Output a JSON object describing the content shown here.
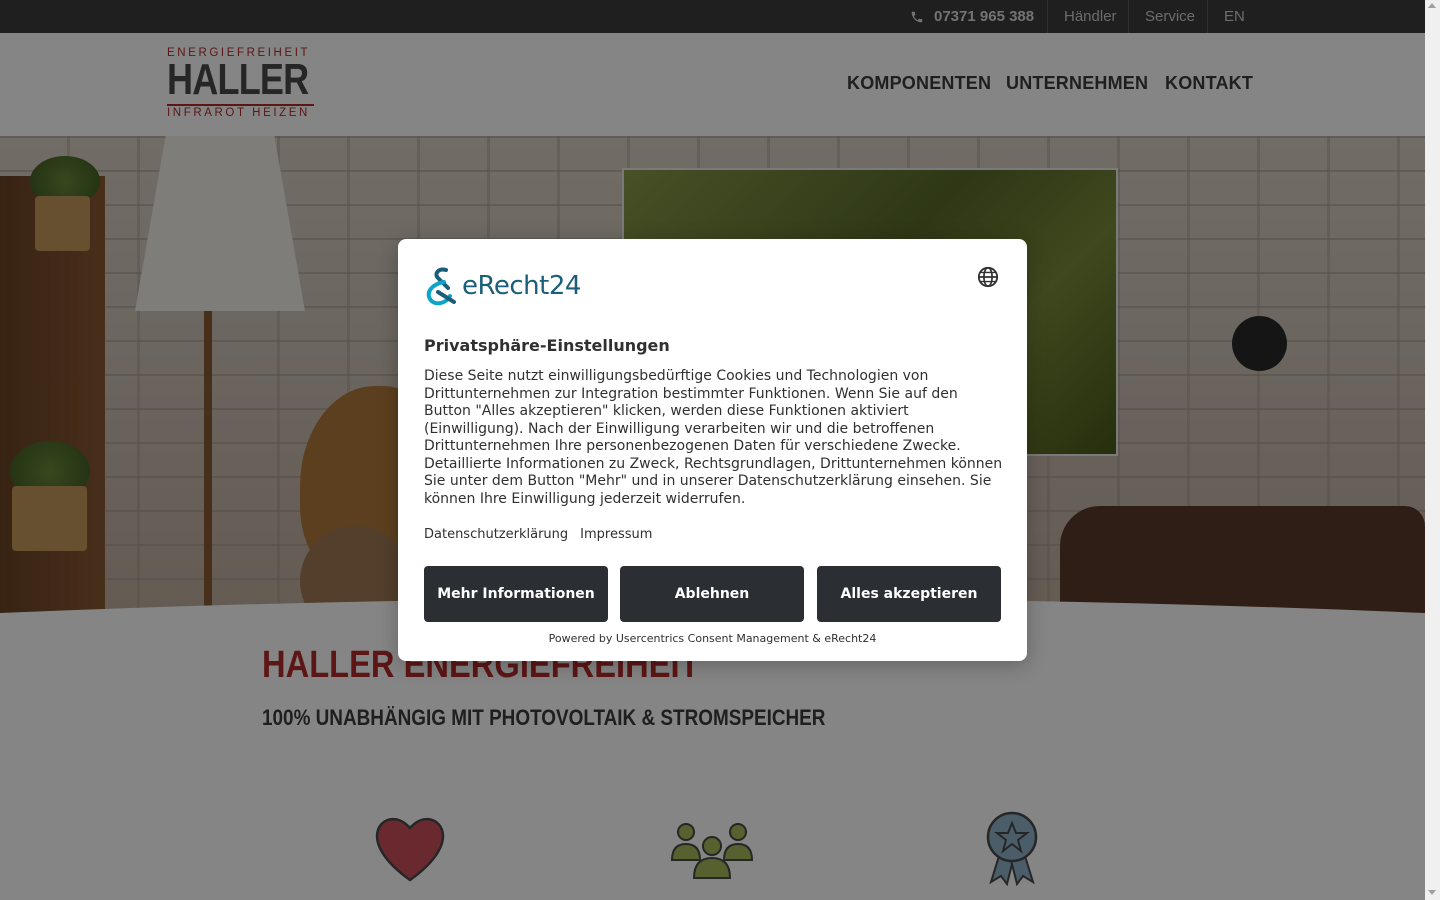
{
  "topbar": {
    "phone": "07371 965 388",
    "links": [
      "Händler",
      "Service",
      "EN"
    ]
  },
  "logo": {
    "line1": "ENERGIEFREIHEIT",
    "brand": "HALLER",
    "line3": "INFRAROT HEIZEN",
    "registered": "®"
  },
  "nav": [
    "KOMPONENTEN",
    "UNTERNEHMEN",
    "KONTAKT"
  ],
  "content": {
    "headline": "HALLER ENERGIEFREIHEIT",
    "subheadline": "100% UNABHÄNGIG MIT PHOTOVOLTAIK & STROMSPEICHER",
    "feature_icons": [
      "heart-icon",
      "people-icon",
      "award-badge-icon"
    ]
  },
  "consent": {
    "brand": "eRecht24",
    "title": "Privatsphäre-Einstellungen",
    "body": "Diese Seite nutzt einwilligungsbedürftige Cookies und Technologien von Drittunternehmen zur Integration bestimmter Funktionen. Wenn Sie auf den Button \"Alles akzeptieren\" klicken, werden diese Funktionen aktiviert (Einwilligung). Nach der Einwilligung verarbeiten wir und die betroffenen Drittunternehmen Ihre personenbezogenen Daten für verschiedene Zwecke. Detaillierte Informationen zu Zweck, Rechtsgrundlagen, Drittunternehmen können Sie unter dem Button \"Mehr\" und in unserer Datenschutzerklärung einsehen. Sie können Ihre Einwilligung jederzeit widerrufen.",
    "links": [
      "Datenschutzerklärung",
      "Impressum"
    ],
    "buttons": {
      "more": "Mehr Informationen",
      "decline": "Ablehnen",
      "accept": "Alles akzeptieren"
    },
    "powered_by": "Powered by Usercentrics Consent Management & eRecht24"
  },
  "colors": {
    "brand_red": "#b22b2b",
    "dark": "#2b2e33",
    "topbar": "#3c3c3c",
    "erecht_teal": "#1b5e7a"
  }
}
